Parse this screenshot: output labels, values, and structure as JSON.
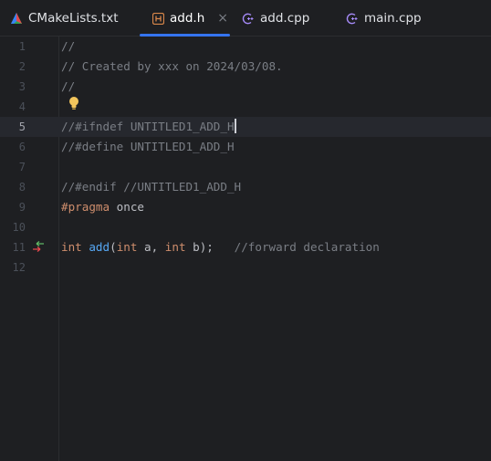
{
  "tabs": [
    {
      "label": "CMakeLists.txt",
      "icon": "cmake-icon",
      "active": false
    },
    {
      "label": "add.h",
      "icon": "header-file-icon",
      "active": true,
      "closable": true
    },
    {
      "label": "add.cpp",
      "icon": "cpp-file-icon",
      "active": false
    },
    {
      "label": "main.cpp",
      "icon": "cpp-file-icon",
      "active": false
    }
  ],
  "editor": {
    "current_line": 5,
    "line_numbers": [
      "1",
      "2",
      "3",
      "4",
      "5",
      "6",
      "7",
      "8",
      "9",
      "10",
      "11",
      "12"
    ],
    "lines": {
      "l1": "//",
      "l2": "// Created by xxx on 2024/03/08.",
      "l3": "//",
      "l5": "//#ifndef UNTITLED1_ADD_H",
      "l6": "//#define UNTITLED1_ADD_H",
      "l8": "//#endif //UNTITLED1_ADD_H",
      "l9_kw": "#pragma",
      "l9_rest": " once",
      "l11_kw1": "int",
      "l11_fn": "add",
      "l11_p1": "(",
      "l11_kw2": "int",
      "l11_p2": " a, ",
      "l11_kw3": "int",
      "l11_p3": " b);   ",
      "l11_comment": "//forward declaration"
    },
    "colors": {
      "background": "#1e1f22",
      "comment": "#7a7e85",
      "keyword": "#cf8e6d",
      "function": "#56a8f5",
      "accent": "#3574f0"
    }
  },
  "gutter_icons": {
    "intention_bulb": "lightbulb-icon",
    "navigate_declaration": "implementation-arrows-icon"
  }
}
